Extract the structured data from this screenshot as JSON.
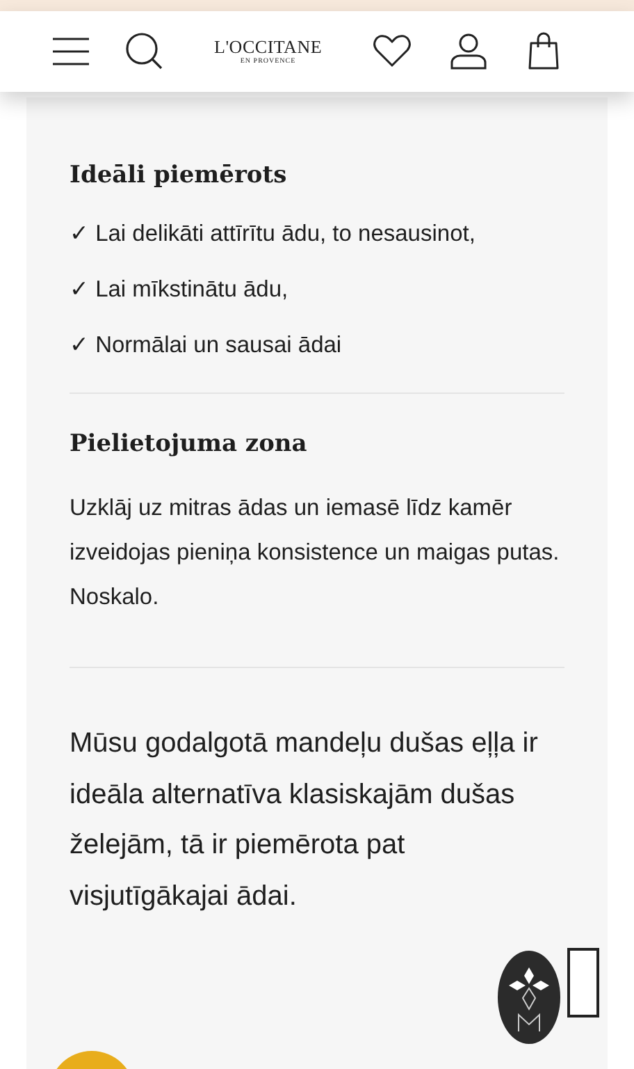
{
  "header": {
    "logo": {
      "name": "L'OCCITANE",
      "tagline": "EN PROVENCE"
    }
  },
  "suitable": {
    "title": "Ideāli piemērots",
    "items": [
      "✓ Lai delikāti attīrītu ādu, to nesausinot,",
      "✓ Lai mīkstinātu ādu,",
      "✓ Normālai un sausai ādai"
    ]
  },
  "usage": {
    "title": "Pielietojuma zona",
    "text": "Uzklāj uz mitras ādas un iemasē līdz kamēr izveidojas pieniņa konsistence un maigas putas. Noskalo."
  },
  "description": "Mūsu godalgotā mandeļu dušas eļļa ir ideāla alternatīva klasiskajām dušas želejām, tā ir piemērota pat visjutīgākajai ādai."
}
